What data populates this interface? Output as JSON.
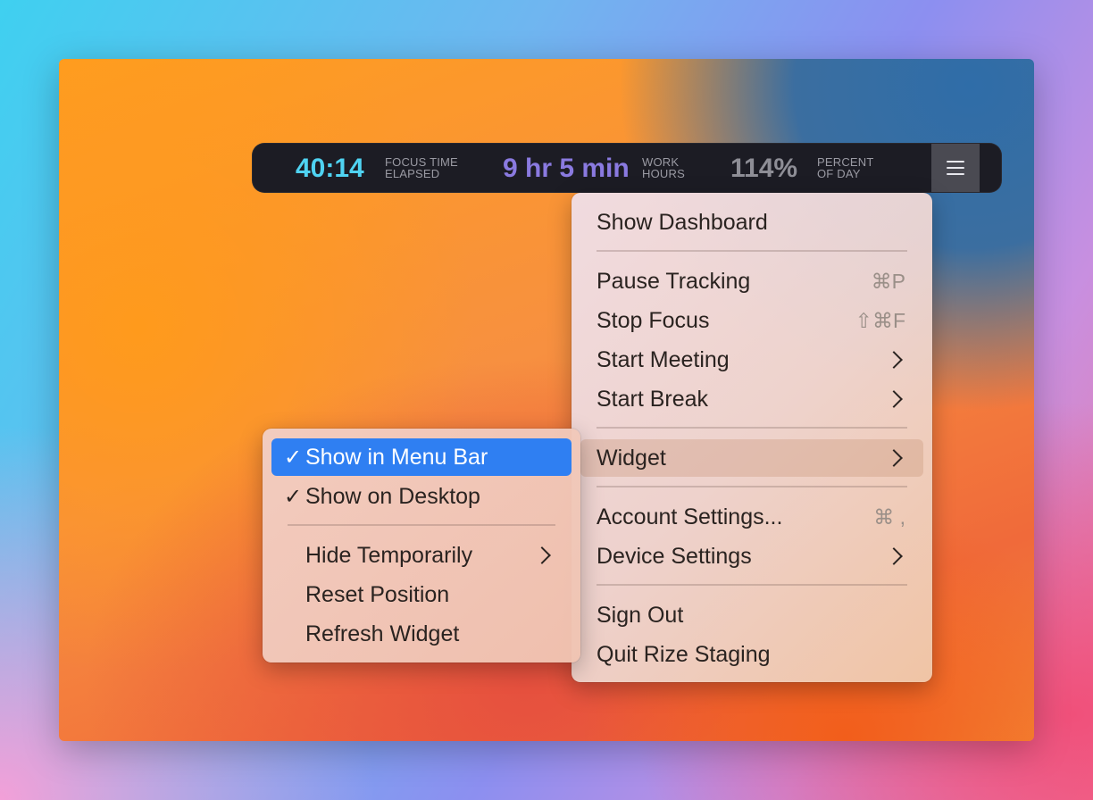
{
  "widget_bar": {
    "focus": {
      "value": "40:14",
      "label_line1": "FOCUS TIME",
      "label_line2": "ELAPSED",
      "color": "#4fd3f2"
    },
    "work": {
      "value": "9 hr 5 min",
      "label_line1": "WORK",
      "label_line2": "HOURS",
      "color": "#8a7ae0"
    },
    "percent": {
      "value": "114%",
      "label_line1": "PERCENT",
      "label_line2": "OF DAY",
      "color": "#8e8e96"
    },
    "menu_icon": "hamburger-menu-icon"
  },
  "main_menu": {
    "show_dashboard": "Show Dashboard",
    "pause_tracking": {
      "label": "Pause Tracking",
      "shortcut": "⌘P"
    },
    "stop_focus": {
      "label": "Stop Focus",
      "shortcut": "⇧⌘F"
    },
    "start_meeting": "Start Meeting",
    "start_break": "Start Break",
    "widget": "Widget",
    "account_settings": {
      "label": "Account Settings...",
      "shortcut": "⌘ ,"
    },
    "device_settings": "Device Settings",
    "sign_out": "Sign Out",
    "quit": "Quit Rize Staging"
  },
  "widget_submenu": {
    "show_in_menu_bar": {
      "label": "Show in Menu Bar",
      "checked": true,
      "check_mark": "✓"
    },
    "show_on_desktop": {
      "label": "Show on Desktop",
      "checked": true,
      "check_mark": "✓"
    },
    "hide_temporarily": "Hide Temporarily",
    "reset_position": "Reset Position",
    "refresh_widget": "Refresh Widget"
  }
}
